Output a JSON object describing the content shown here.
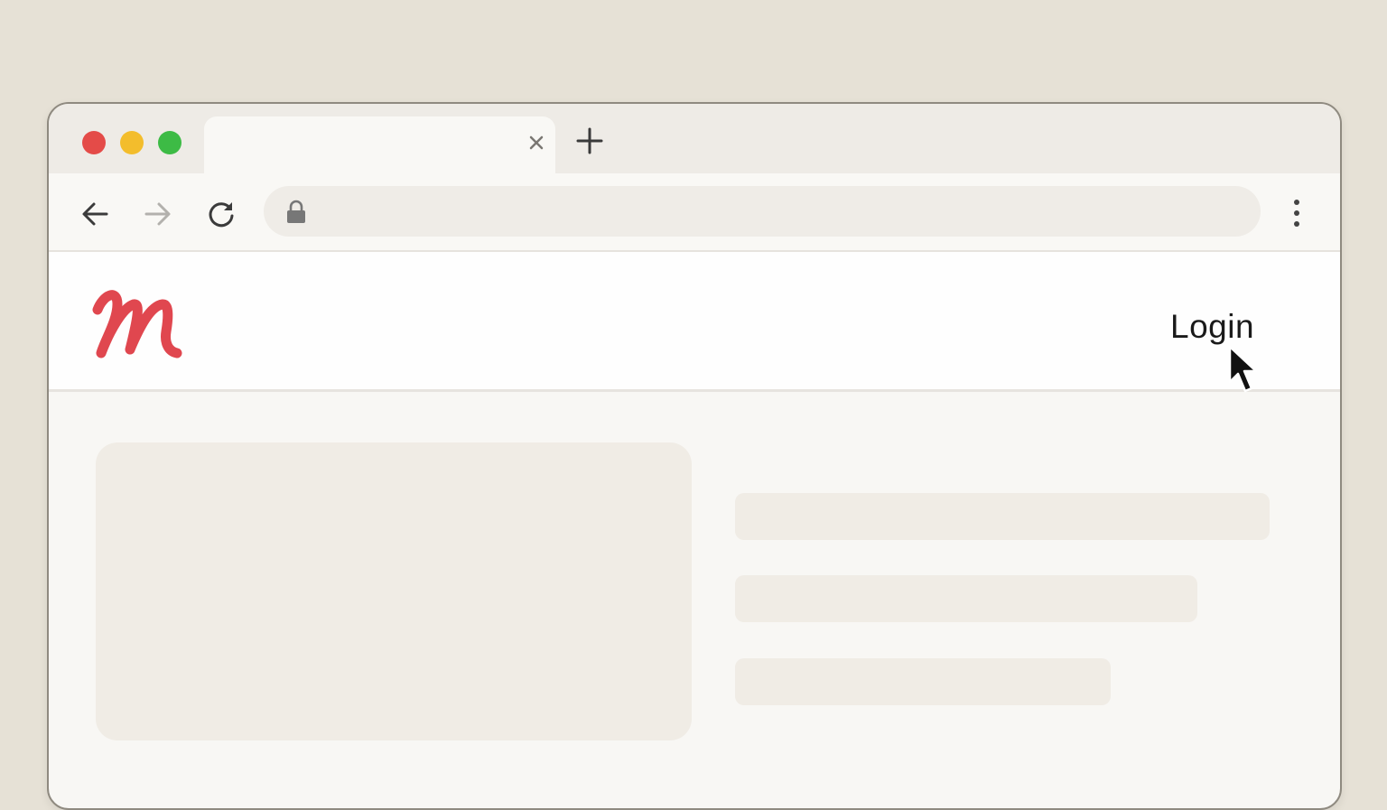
{
  "browser": {
    "traffic_lights": {
      "close_color": "#e44b48",
      "minimize_color": "#f3bd2c",
      "maximize_color": "#3dbb45"
    },
    "tab": {
      "title": "",
      "close_icon": "close-icon"
    },
    "new_tab_icon": "plus-icon",
    "toolbar": {
      "back_icon": "arrow-left-icon",
      "forward_icon": "arrow-right-icon",
      "reload_icon": "reload-icon",
      "menu_icon": "kebab-menu-icon"
    },
    "address_bar": {
      "url": "",
      "lock_icon": "lock-icon"
    }
  },
  "site": {
    "logo_letter": "M",
    "logo_color": "#e0474f",
    "login_label": "Login"
  },
  "cursor": "arrow-cursor"
}
